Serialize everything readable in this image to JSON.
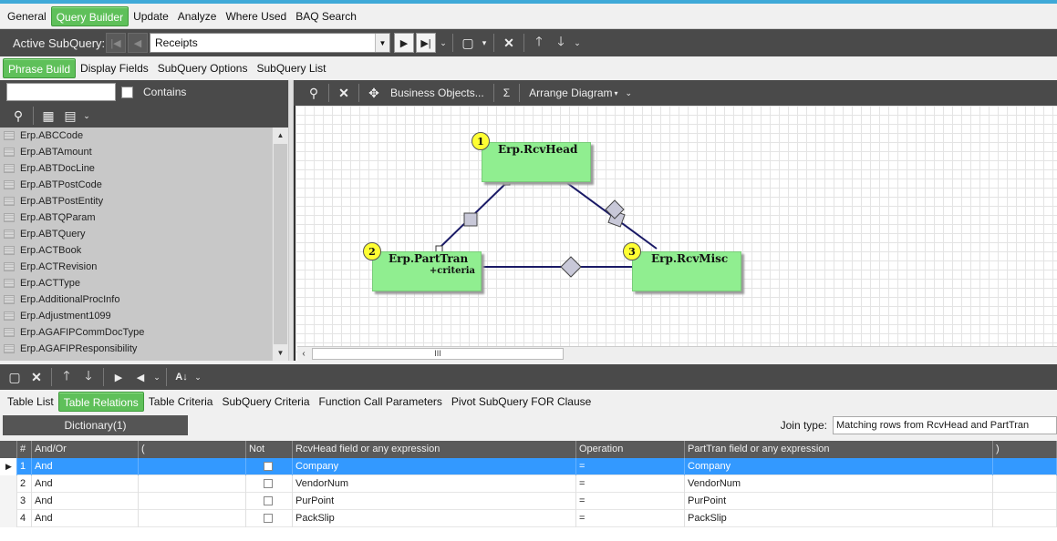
{
  "colors": {
    "accent_green": "#5fc05a",
    "dark_toolbar": "#4a4a4a",
    "node_fill": "#90ee90",
    "badge_fill": "#ffff33",
    "selection": "#3399ff"
  },
  "main_tabs": [
    "General",
    "Query Builder",
    "Update",
    "Analyze",
    "Where Used",
    "BAQ Search"
  ],
  "subquery_bar": {
    "label": "Active SubQuery:",
    "value": "Receipts"
  },
  "sub_tabs": [
    "Phrase Build",
    "Display Fields",
    "SubQuery Options",
    "SubQuery List"
  ],
  "left_panel": {
    "search_value": "",
    "contains_label": "Contains",
    "tables": [
      "Erp.ABCCode",
      "Erp.ABTAmount",
      "Erp.ABTDocLine",
      "Erp.ABTPostCode",
      "Erp.ABTPostEntity",
      "Erp.ABTQParam",
      "Erp.ABTQuery",
      "Erp.ACTBook",
      "Erp.ACTRevision",
      "Erp.ACTType",
      "Erp.AdditionalProcInfo",
      "Erp.Adjustment1099",
      "Erp.AGAFIPCommDocType",
      "Erp.AGAFIPResponsibility"
    ]
  },
  "diagram_toolbar": {
    "business_objects": "Business Objects...",
    "sigma": "Σ",
    "arrange": "Arrange Diagram"
  },
  "diagram": {
    "nodes": [
      {
        "num": "1",
        "name": "Erp.RcvHead",
        "extra": ""
      },
      {
        "num": "2",
        "name": "Erp.PartTran",
        "extra": "+criteria"
      },
      {
        "num": "3",
        "name": "Erp.RcvMisc",
        "extra": ""
      }
    ],
    "scroll_grip": "III"
  },
  "bottom_tabs": [
    "Table List",
    "Table Relations",
    "Table Criteria",
    "SubQuery Criteria",
    "Function Call Parameters",
    "Pivot SubQuery FOR Clause"
  ],
  "relations": {
    "dictionary_label": "Dictionary(1)",
    "join_type_label": "Join type:",
    "join_type_value": "Matching rows from RcvHead and PartTran",
    "columns": [
      "#",
      "And/Or",
      "(",
      "Not",
      "RcvHead field or any expression",
      "Operation",
      "PartTran field or any expression",
      ")"
    ],
    "rows": [
      {
        "num": "1",
        "andor": "And",
        "field": "Company",
        "op": "=",
        "other": "Company"
      },
      {
        "num": "2",
        "andor": "And",
        "field": "VendorNum",
        "op": "=",
        "other": "VendorNum"
      },
      {
        "num": "3",
        "andor": "And",
        "field": "PurPoint",
        "op": "=",
        "other": "PurPoint"
      },
      {
        "num": "4",
        "andor": "And",
        "field": "PackSlip",
        "op": "=",
        "other": "PackSlip"
      }
    ]
  }
}
